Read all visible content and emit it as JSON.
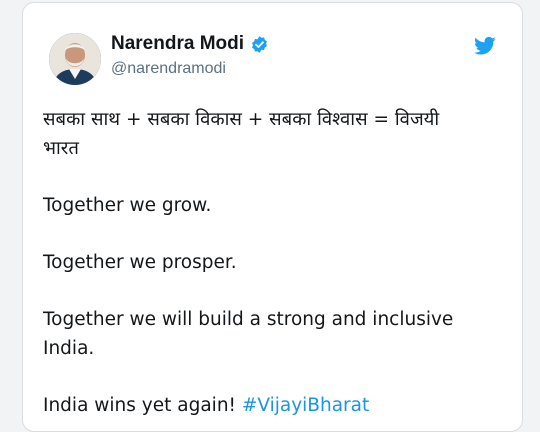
{
  "author": {
    "name": "Narendra Modi",
    "handle": "@narendramodi",
    "avatar_icon": "avatar-portrait",
    "verified_icon": "verified-badge-icon",
    "platform_icon": "twitter-bird-icon"
  },
  "tweet": {
    "line1": "सबका साथ + सबका विकास + सबका विश्वास = विजयी",
    "line2": "भारत",
    "line3": "Together we grow.",
    "line4": "Together we prosper.",
    "line5": "Together we will build a strong and inclusive",
    "line6": "India.",
    "line7_text": "India wins yet again! ",
    "line7_hashtag": "#VijayiBharat"
  },
  "colors": {
    "brand_blue": "#1da1f2",
    "hashtag_blue": "#1b95e0",
    "text": "#14171a",
    "handle_gray": "#5b7083"
  }
}
